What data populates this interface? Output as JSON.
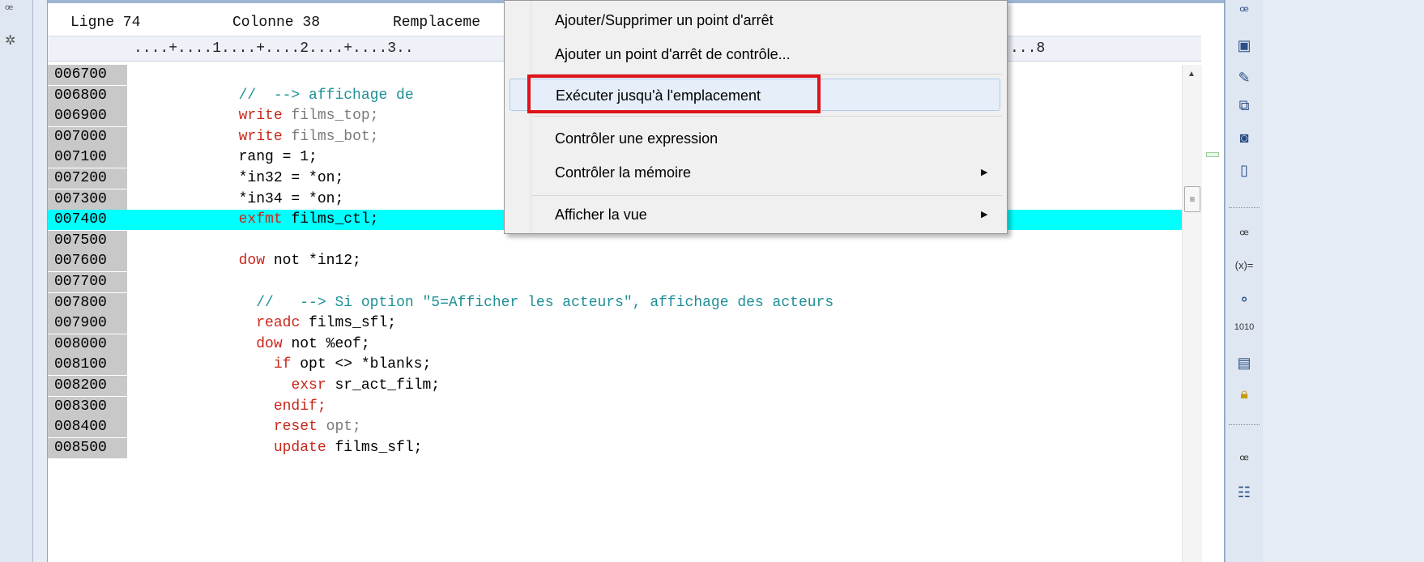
{
  "editor": {
    "status": {
      "line": "Ligne 74",
      "column": "Colonne 38",
      "mode": "Remplaceme"
    },
    "ruler": "....+....1....+....2....+....3..",
    "ruler_tail": "...8",
    "lines": [
      {
        "num": "006700",
        "parts": []
      },
      {
        "num": "006800",
        "parts": [
          {
            "t": "            "
          },
          {
            "t": "//  --> affichage de",
            "c": "cm"
          }
        ]
      },
      {
        "num": "006900",
        "parts": [
          {
            "t": "            "
          },
          {
            "t": "write",
            "c": "kw"
          },
          {
            "t": " "
          },
          {
            "t": "films_top;",
            "c": "gy"
          }
        ]
      },
      {
        "num": "007000",
        "parts": [
          {
            "t": "            "
          },
          {
            "t": "write",
            "c": "kw"
          },
          {
            "t": " "
          },
          {
            "t": "films_bot;",
            "c": "gy"
          }
        ]
      },
      {
        "num": "007100",
        "parts": [
          {
            "t": "            rang = 1;"
          }
        ]
      },
      {
        "num": "007200",
        "parts": [
          {
            "t": "            *in32 = *on;"
          }
        ]
      },
      {
        "num": "007300",
        "parts": [
          {
            "t": "            *in34 = *on;"
          }
        ]
      },
      {
        "num": "007400",
        "hl": true,
        "parts": [
          {
            "t": "            "
          },
          {
            "t": "exfmt",
            "c": "kw"
          },
          {
            "t": " films_ctl;"
          }
        ]
      },
      {
        "num": "007500",
        "parts": []
      },
      {
        "num": "007600",
        "parts": [
          {
            "t": "            "
          },
          {
            "t": "dow",
            "c": "kw"
          },
          {
            "t": " not *in12;"
          }
        ]
      },
      {
        "num": "007700",
        "parts": []
      },
      {
        "num": "007800",
        "parts": [
          {
            "t": "              "
          },
          {
            "t": "//   --> Si option \"5=Afficher les acteurs\", affichage des acteurs",
            "c": "cm"
          }
        ]
      },
      {
        "num": "007900",
        "parts": [
          {
            "t": "              "
          },
          {
            "t": "readc",
            "c": "kw"
          },
          {
            "t": " films_sfl;"
          }
        ]
      },
      {
        "num": "008000",
        "parts": [
          {
            "t": "              "
          },
          {
            "t": "dow",
            "c": "kw"
          },
          {
            "t": " not %eof;"
          }
        ]
      },
      {
        "num": "008100",
        "parts": [
          {
            "t": "                "
          },
          {
            "t": "if",
            "c": "kw"
          },
          {
            "t": " opt <> *blanks;"
          }
        ]
      },
      {
        "num": "008200",
        "parts": [
          {
            "t": "                  "
          },
          {
            "t": "exsr",
            "c": "kw"
          },
          {
            "t": " sr_act_film;"
          }
        ]
      },
      {
        "num": "008300",
        "parts": [
          {
            "t": "                "
          },
          {
            "t": "endif;",
            "c": "kw"
          }
        ]
      },
      {
        "num": "008400",
        "parts": [
          {
            "t": "                "
          },
          {
            "t": "reset",
            "c": "kw"
          },
          {
            "t": " "
          },
          {
            "t": "opt;",
            "c": "gy"
          }
        ]
      },
      {
        "num": "008500",
        "parts": [
          {
            "t": "                "
          },
          {
            "t": "update",
            "c": "kw"
          },
          {
            "t": " films_sfl;"
          }
        ]
      }
    ]
  },
  "context_menu": {
    "items": [
      {
        "label": "Ajouter/Supprimer un point d'arrêt"
      },
      {
        "label": "Ajouter un point d'arrêt de contrôle..."
      },
      {
        "label": "Exécuter jusqu'à l'emplacement"
      },
      {
        "label": "Contrôler une expression"
      },
      {
        "label": "Contrôler la mémoire",
        "submenu": true
      },
      {
        "label": "Afficher la vue",
        "submenu": true
      }
    ]
  },
  "right_toolbar": {
    "icons": [
      "restore-icon",
      "monitor-icon",
      "edit-sheet-icon",
      "window-list-icon",
      "debug-monitor-icon",
      "database-icon",
      "restore-icon",
      "variables-icon",
      "breakpoints-icon",
      "memory-icon",
      "expressions-icon",
      "lock-icon",
      "restore-icon",
      "outline-icon"
    ],
    "glyphs": {
      "variables": "(x)=",
      "memory": "1010"
    }
  },
  "colors": {
    "highlight_line": "#00ffff",
    "keyword": "#c8271b",
    "comment": "#1e8f96",
    "annotation": "#e0121a"
  }
}
